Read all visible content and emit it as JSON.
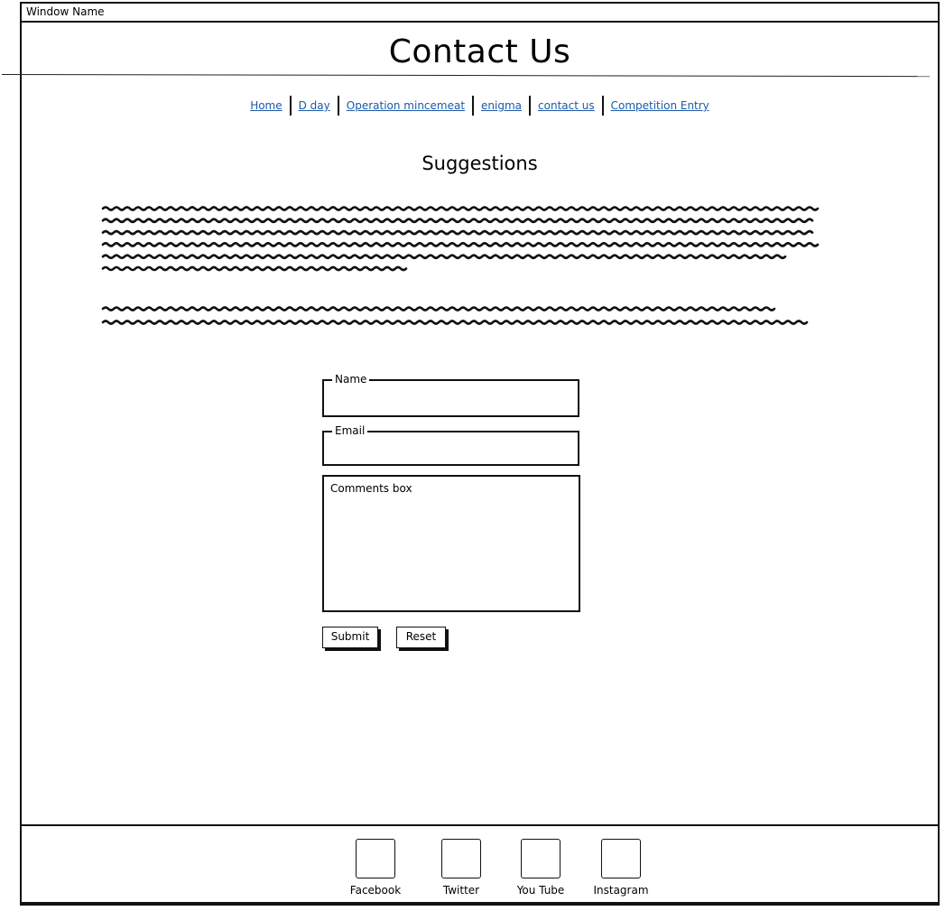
{
  "window": {
    "title": "Window Name"
  },
  "page": {
    "title": "Contact Us"
  },
  "nav": {
    "items": [
      {
        "label": "Home"
      },
      {
        "label": "D day"
      },
      {
        "label": "Operation mincemeat"
      },
      {
        "label": "enigma"
      },
      {
        "label": "contact us"
      },
      {
        "label": "Competition Entry"
      }
    ]
  },
  "suggestions": {
    "heading": "Suggestions"
  },
  "form": {
    "name_label": "Name",
    "name_value": "",
    "email_label": "Email",
    "email_value": "",
    "comments_placeholder": "Comments box",
    "submit_label": "Submit",
    "reset_label": "Reset"
  },
  "footer": {
    "social": [
      {
        "label": "Facebook",
        "icon": "facebook-icon"
      },
      {
        "label": "Twitter",
        "icon": "twitter-icon"
      },
      {
        "label": "You Tube",
        "icon": "youtube-icon"
      },
      {
        "label": "Instagram",
        "icon": "instagram-icon"
      }
    ]
  }
}
